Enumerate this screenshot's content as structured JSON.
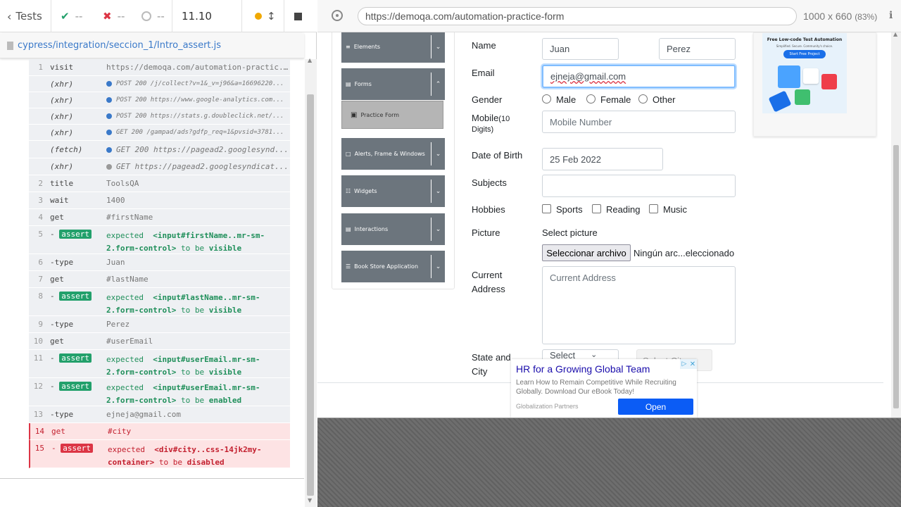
{
  "runner": {
    "tests_label": "Tests",
    "passed": "--",
    "failed": "--",
    "pending": "--",
    "duration": "11.10",
    "spec_path": "cypress/integration/seccion_1/Intro_assert.js"
  },
  "commands": [
    {
      "n": "1",
      "cmd": "visit",
      "msg": "https://demoqa.com/automation-practic..."
    },
    {
      "n": "",
      "cmd": "(xhr)",
      "msg": "POST 200 /j/collect?v=1&_v=j96&a=16696220..."
    },
    {
      "n": "",
      "cmd": "(xhr)",
      "msg": "POST 200 https://www.google-analytics.com..."
    },
    {
      "n": "",
      "cmd": "(xhr)",
      "msg": "POST 200 https://stats.g.doubleclick.net/..."
    },
    {
      "n": "",
      "cmd": "(xhr)",
      "msg": "GET 200 /gampad/ads?gdfp_req=1&pvsid=3781..."
    },
    {
      "n": "",
      "cmd": "(fetch)",
      "msg": "GET 200 https://pagead2.googlesynd..."
    },
    {
      "n": "",
      "cmd": "(xhr)",
      "msg": "GET https://pagead2.googlesyndicat..."
    },
    {
      "n": "2",
      "cmd": "title",
      "msg": "ToolsQA"
    },
    {
      "n": "3",
      "cmd": "wait",
      "msg": "1400"
    },
    {
      "n": "4",
      "cmd": "get",
      "msg": "#firstName"
    },
    {
      "n": "5",
      "cmd": "assert",
      "l1": "expected",
      "l2": "<input#firstName..mr-sm-",
      "l3": "2.form-control>",
      "l4": "to be",
      "l5": "visible"
    },
    {
      "n": "6",
      "cmd": "-type",
      "msg": "Juan"
    },
    {
      "n": "7",
      "cmd": "get",
      "msg": "#lastName"
    },
    {
      "n": "8",
      "cmd": "assert",
      "l1": "expected",
      "l2": "<input#lastName..mr-sm-",
      "l3": "2.form-control>",
      "l4": "to be",
      "l5": "visible"
    },
    {
      "n": "9",
      "cmd": "-type",
      "msg": "Perez"
    },
    {
      "n": "10",
      "cmd": "get",
      "msg": "#userEmail"
    },
    {
      "n": "11",
      "cmd": "assert",
      "l1": "expected",
      "l2": "<input#userEmail.mr-sm-",
      "l3": "2.form-control>",
      "l4": "to be",
      "l5": "visible"
    },
    {
      "n": "12",
      "cmd": "assert",
      "l1": "expected",
      "l2": "<input#userEmail.mr-sm-",
      "l3": "2.form-control>",
      "l4": "to be",
      "l5": "enabled"
    },
    {
      "n": "13",
      "cmd": "-type",
      "msg": "ejneja@gmail.com"
    },
    {
      "n": "14",
      "cmd": "get",
      "msg": "#city"
    },
    {
      "n": "15",
      "cmd": "assert",
      "l1": "expected",
      "l2": "<div#city..css-14jk2my-",
      "l3": "container>",
      "l4": "to be",
      "l5": "disabled"
    }
  ],
  "browser": {
    "url": "https://demoqa.com/automation-practice-form",
    "viewport": "1000 x 660",
    "zoom": "(83%)"
  },
  "menu": [
    {
      "label": "Elements"
    },
    {
      "label": "Forms"
    },
    {
      "label": "Practice Form"
    },
    {
      "label": "Alerts, Frame & Windows"
    },
    {
      "label": "Widgets"
    },
    {
      "label": "Interactions"
    },
    {
      "label": "Book Store Application"
    }
  ],
  "form": {
    "name_label": "Name",
    "first_name": "Juan",
    "last_name": "Perez",
    "email_label": "Email",
    "email": "ejneja@gmail.com",
    "gender_label": "Gender",
    "gender_options": [
      "Male",
      "Female",
      "Other"
    ],
    "mobile_label": "Mobile",
    "mobile_sub": "(10",
    "mobile_sub2": "Digits)",
    "mobile_placeholder": "Mobile Number",
    "dob_label": "Date of Birth",
    "dob": "25 Feb 2022",
    "subjects_label": "Subjects",
    "hobbies_label": "Hobbies",
    "hobbies": [
      "Sports",
      "Reading",
      "Music"
    ],
    "picture_label": "Picture",
    "select_picture": "Select picture",
    "file_button": "Seleccionar archivo",
    "file_status": "Ningún arc...eleccionado",
    "address_label1": "Current",
    "address_label2": "Address",
    "address_placeholder": "Current Address",
    "state_label1": "State and",
    "state_label2": "City",
    "state_placeholder": "Select",
    "city_placeholder": "Select City"
  },
  "ad_banner": {
    "title": "Free Low-code Test Automation",
    "subtitle": "Simplified. Secure. Community's choice.",
    "button": "Start Free Project"
  },
  "ad_popup": {
    "headline": "HR for a Growing Global Team",
    "body": "Learn How to Remain Competitive While Recruiting Globally. Download Our eBook Today!",
    "brand": "Globalization Partners",
    "button": "Open"
  }
}
